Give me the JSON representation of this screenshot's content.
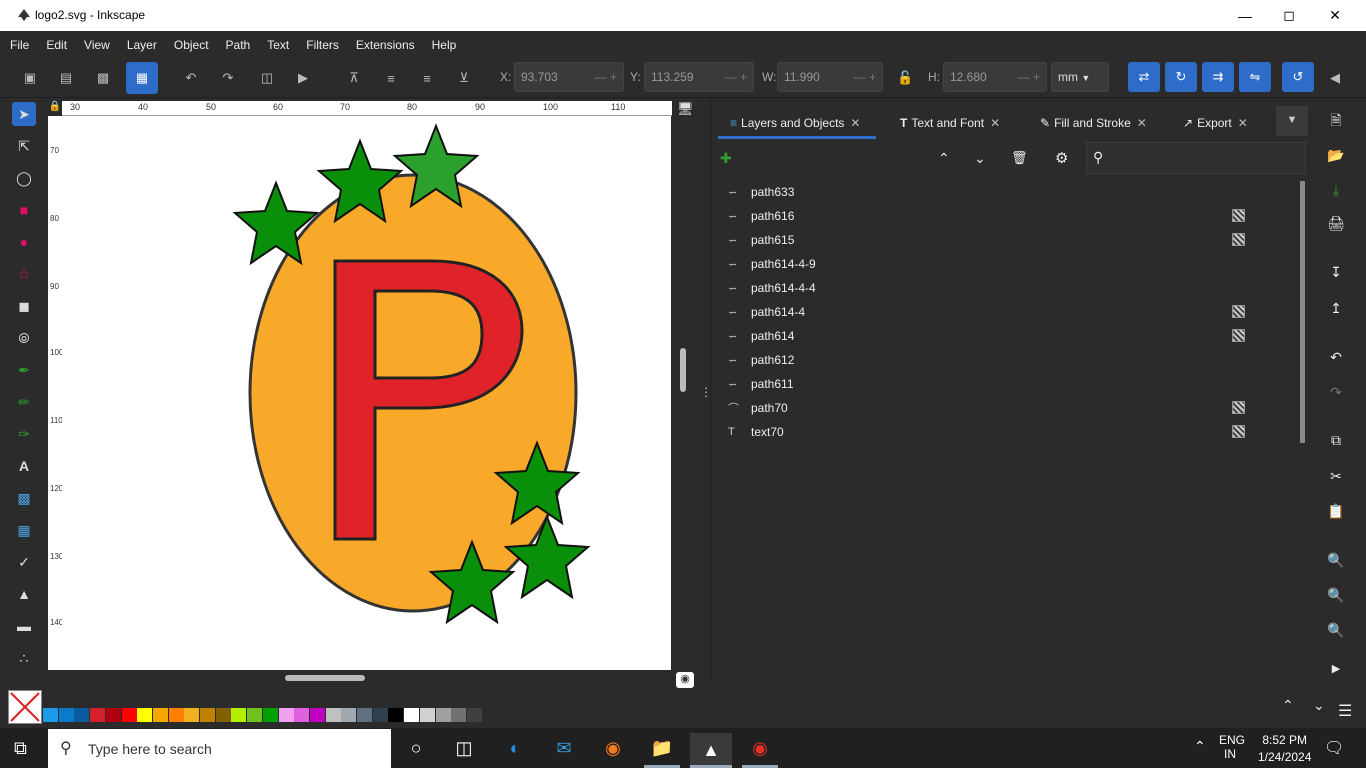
{
  "window": {
    "title": "logo2.svg - Inkscape"
  },
  "menu": [
    "File",
    "Edit",
    "View",
    "Layer",
    "Object",
    "Path",
    "Text",
    "Filters",
    "Extensions",
    "Help"
  ],
  "toolbar": {
    "x_label": "X:",
    "x_value": "93.703",
    "y_label": "Y:",
    "y_value": "113.259",
    "w_label": "W:",
    "w_value": "11.990",
    "h_label": "H:",
    "h_value": "12.680",
    "unit": "mm"
  },
  "ruler_top": [
    "30",
    "40",
    "50",
    "60",
    "70",
    "80",
    "90",
    "100",
    "110"
  ],
  "ruler_left": [
    "70",
    "80",
    "90",
    "100",
    "110",
    "120",
    "130",
    "140"
  ],
  "tabs": [
    {
      "label": "Layers and Objects"
    },
    {
      "label": "Text and Font"
    },
    {
      "label": "Fill and Stroke"
    },
    {
      "label": "Export"
    }
  ],
  "objects": [
    {
      "name": "path633",
      "type": "path",
      "hidden": false
    },
    {
      "name": "path616",
      "type": "path",
      "hidden": true
    },
    {
      "name": "path615",
      "type": "path",
      "hidden": true
    },
    {
      "name": "path614-4-9",
      "type": "path",
      "hidden": false
    },
    {
      "name": "path614-4-4",
      "type": "path",
      "hidden": false
    },
    {
      "name": "path614-4",
      "type": "path",
      "hidden": true
    },
    {
      "name": "path614",
      "type": "path",
      "hidden": true
    },
    {
      "name": "path612",
      "type": "path",
      "hidden": false
    },
    {
      "name": "path611",
      "type": "path",
      "hidden": false
    },
    {
      "name": "path70",
      "type": "arc",
      "hidden": true
    },
    {
      "name": "text70",
      "type": "text",
      "hidden": true
    }
  ],
  "palette": [
    "#1e9be8",
    "#0a7bc8",
    "#0a5aa0",
    "#d4202a",
    "#b00010",
    "#ff0000",
    "#ffff00",
    "#f5a600",
    "#ff7f00",
    "#f0b020",
    "#c08000",
    "#806000",
    "#b0f000",
    "#70c020",
    "#00a000",
    "#f0a0f0",
    "#e060e0",
    "#c000c0",
    "#c0c0c0",
    "#a0a8b0",
    "#607080",
    "#304050",
    "#000000",
    "#ffffff",
    "#d0d0d0",
    "#a0a0a0",
    "#707070",
    "#404040"
  ],
  "taskbar": {
    "search_placeholder": "Type here to search",
    "lang1": "ENG",
    "lang2": "IN",
    "time": "8:52 PM",
    "date": "1/24/2024"
  },
  "colors": {
    "accent": "#2e6cc9",
    "egg": "#f8a92a",
    "letter": "#e02328",
    "star": "#0a8f0a"
  }
}
